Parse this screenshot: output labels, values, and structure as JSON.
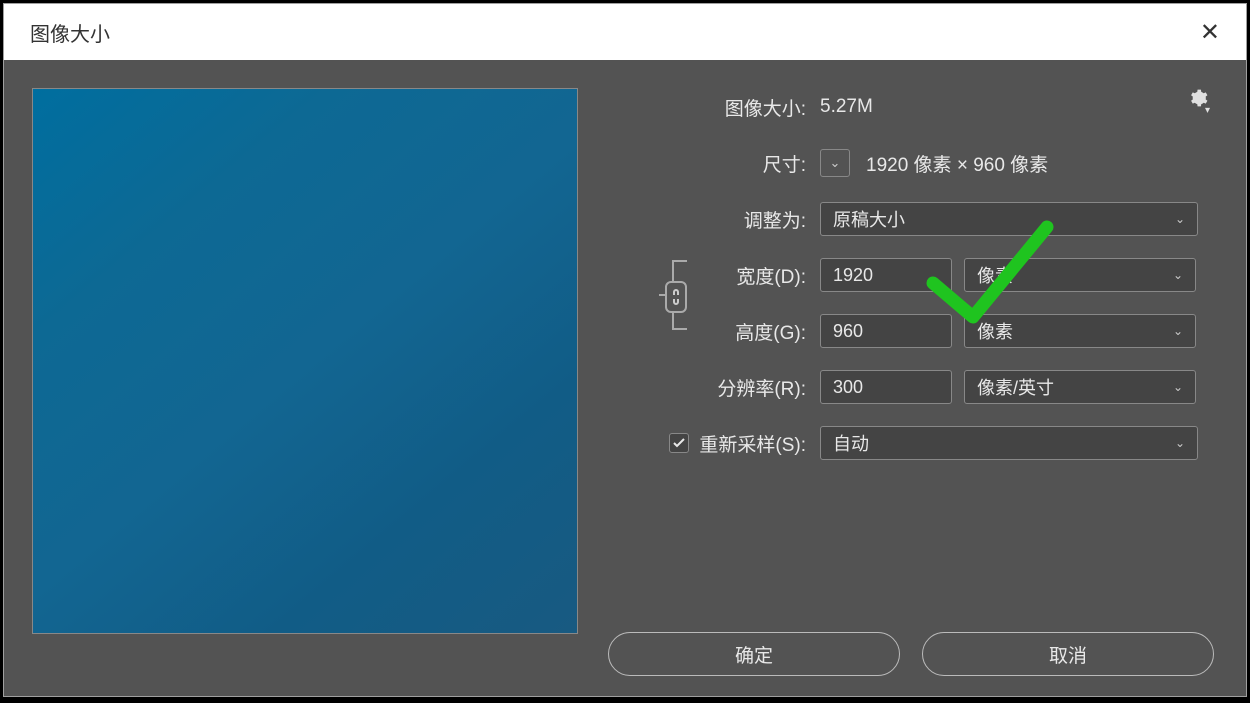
{
  "window": {
    "title": "图像大小"
  },
  "labels": {
    "image_size": "图像大小:",
    "dimensions": "尺寸:",
    "fit_to": "调整为:",
    "width": "宽度(D):",
    "height": "高度(G):",
    "resolution": "分辨率(R):",
    "resample": "重新采样(S):"
  },
  "values": {
    "image_size": "5.27M",
    "dimensions": "1920 像素 × 960 像素",
    "fit_to": "原稿大小",
    "width": "1920",
    "height": "960",
    "resolution": "300",
    "unit_pixels": "像素",
    "unit_resolution": "像素/英寸",
    "resample_method": "自动"
  },
  "buttons": {
    "ok": "确定",
    "cancel": "取消"
  }
}
